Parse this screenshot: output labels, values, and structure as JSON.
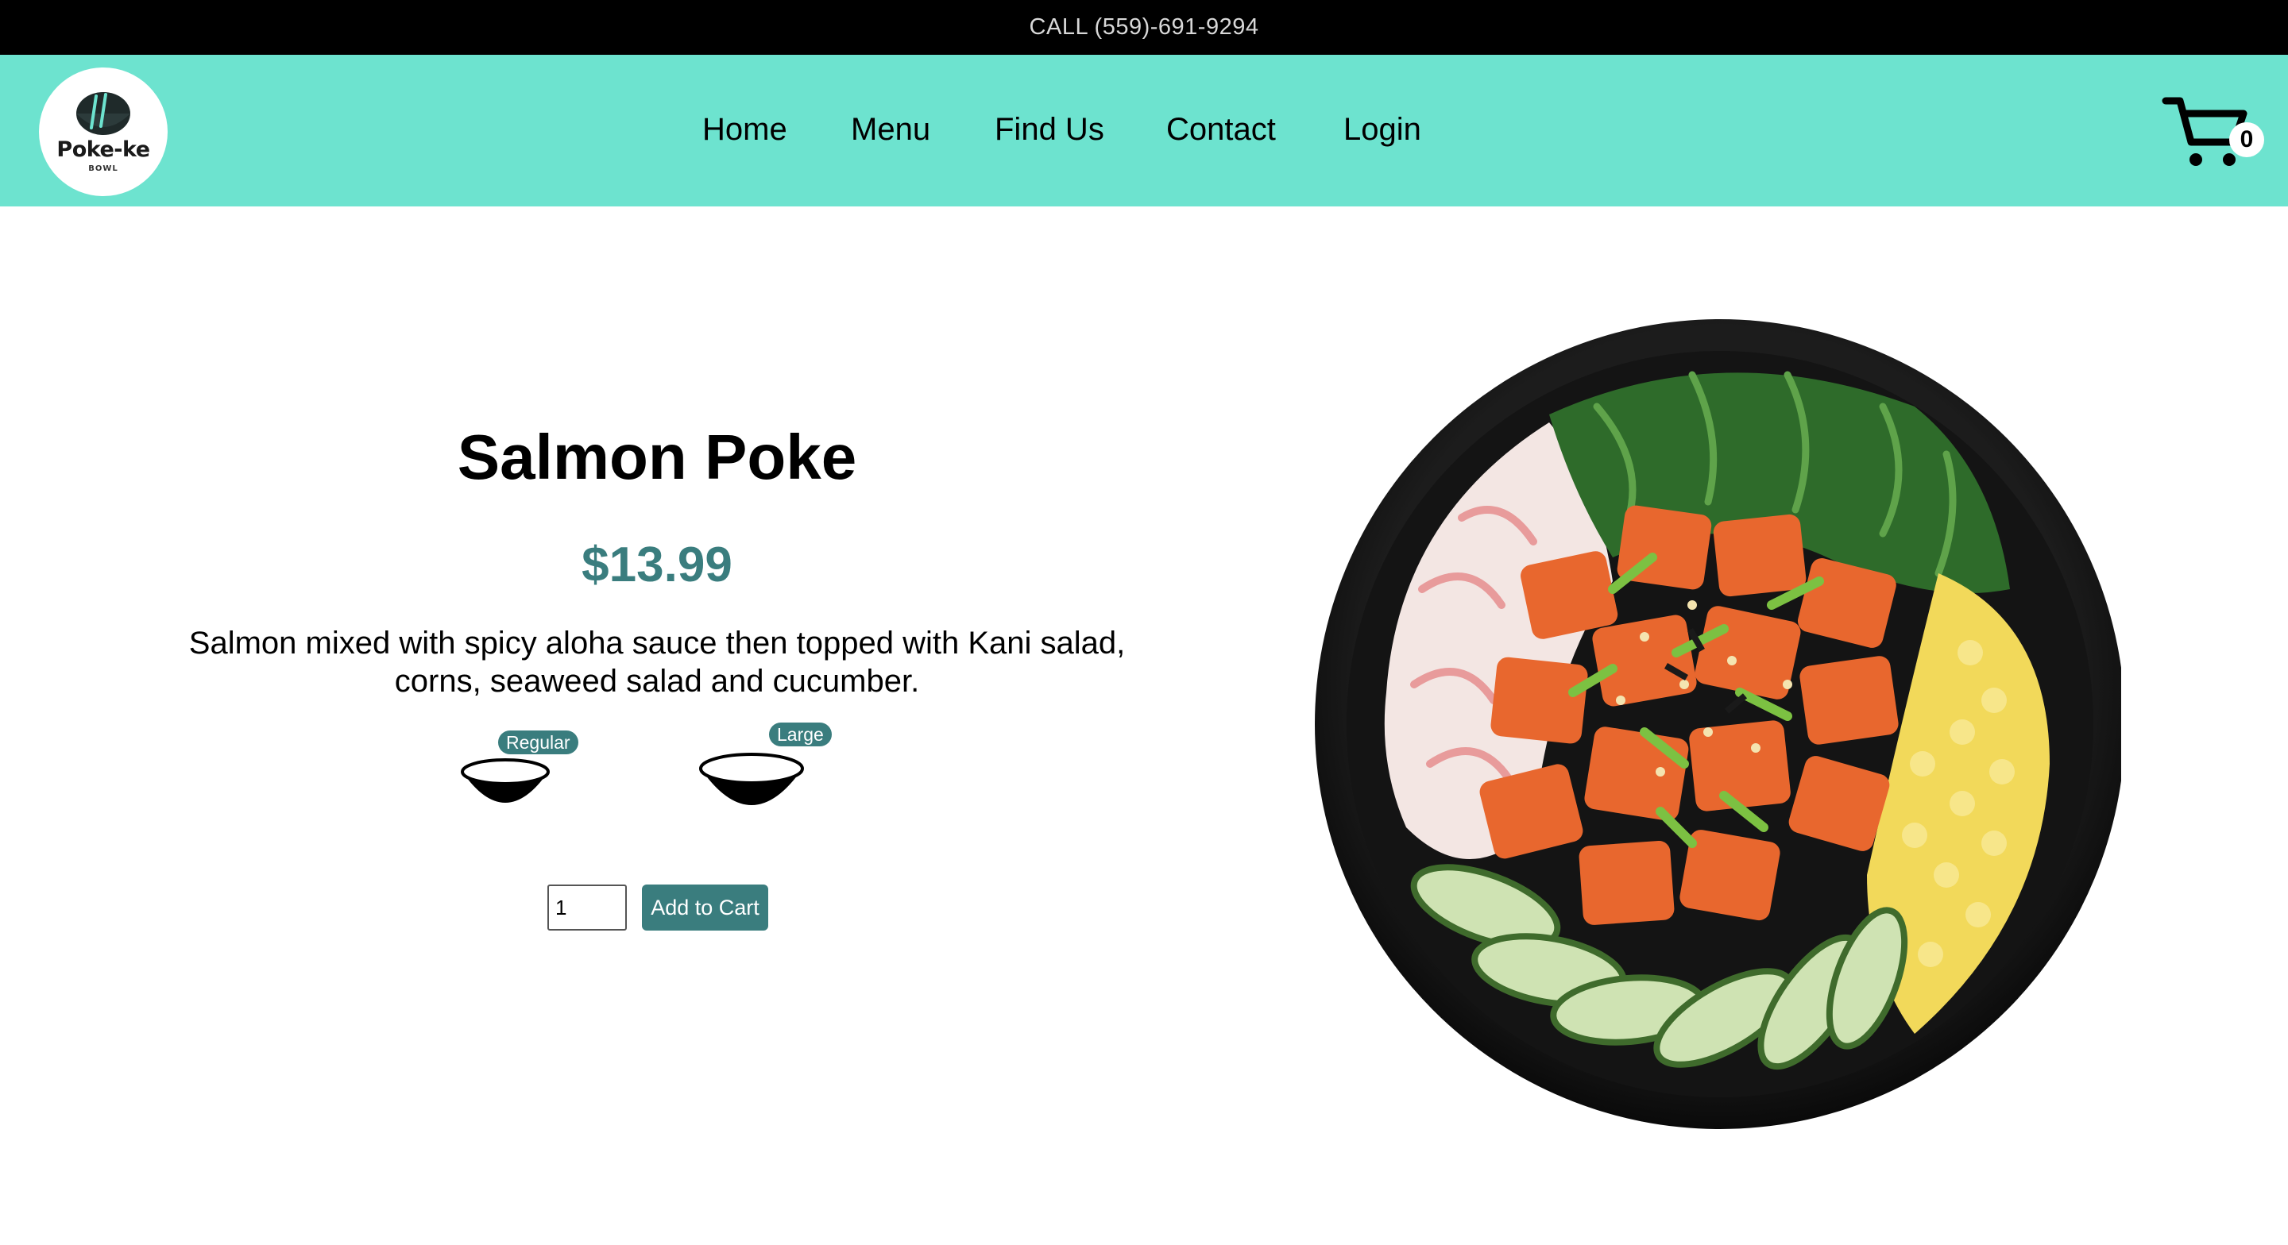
{
  "topbar": {
    "phone_text": "CALL (559)-691-9294"
  },
  "brand": {
    "logo_text": "Poke-ke",
    "logo_sub": "BOWL",
    "nav_color": "#6de3cf"
  },
  "nav": {
    "items": [
      {
        "label": "Home"
      },
      {
        "label": "Menu"
      },
      {
        "label": "Find Us"
      },
      {
        "label": "Contact"
      },
      {
        "label": "Login"
      }
    ]
  },
  "cart": {
    "count": "0",
    "icon": "shopping-cart-icon"
  },
  "product": {
    "title": "Salmon Poke",
    "price": "$13.99",
    "description": "Salmon mixed with spicy aloha sauce then topped with Kani salad, corns, seaweed salad and cucumber.",
    "price_color": "#3a7d7e",
    "sizes": [
      {
        "label": "Regular",
        "icon": "bowl-icon"
      },
      {
        "label": "Large",
        "icon": "bowl-icon"
      }
    ],
    "quantity": "1",
    "add_to_cart_label": "Add to Cart",
    "image": "salmon-poke-bowl-image"
  }
}
